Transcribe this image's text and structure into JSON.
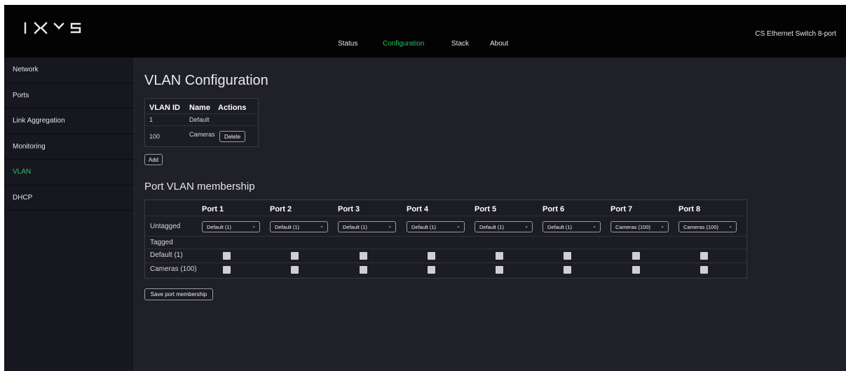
{
  "header": {
    "logo_text": "IXXS",
    "nav": [
      {
        "label": "Status",
        "active": false
      },
      {
        "label": "Configuration",
        "active": true
      },
      {
        "label": "Stack",
        "active": false
      },
      {
        "label": "About",
        "active": false
      }
    ],
    "device_name": "CS Ethernet Switch 8-port"
  },
  "sidebar": {
    "items": [
      {
        "label": "Network",
        "active": false
      },
      {
        "label": "Ports",
        "active": false
      },
      {
        "label": "Link Aggregation",
        "active": false
      },
      {
        "label": "Monitoring",
        "active": false
      },
      {
        "label": "VLAN",
        "active": true
      },
      {
        "label": "DHCP",
        "active": false
      }
    ]
  },
  "main": {
    "title": "VLAN Configuration",
    "vlan_table": {
      "headers": [
        "VLAN ID",
        "Name",
        "Actions"
      ],
      "rows": [
        {
          "id": "1",
          "name": "Default",
          "action": ""
        },
        {
          "id": "100",
          "name": "Cameras",
          "action": "Delete"
        }
      ]
    },
    "add_label": "Add",
    "membership_title": "Port VLAN membership",
    "port_table": {
      "ports": [
        "Port 1",
        "Port 2",
        "Port 3",
        "Port 4",
        "Port 5",
        "Port 6",
        "Port 7",
        "Port 8"
      ],
      "untagged_label": "Untagged",
      "untagged_values": [
        "Default (1)",
        "Default (1)",
        "Default (1)",
        "Default (1)",
        "Default (1)",
        "Default (1)",
        "Cameras (100)",
        "Cameras (100)"
      ],
      "tagged_label": "Tagged",
      "tagged_rows": [
        {
          "label": "Default (1)",
          "checked": [
            false,
            false,
            false,
            false,
            false,
            false,
            false,
            false
          ]
        },
        {
          "label": "Cameras (100)",
          "checked": [
            false,
            false,
            false,
            false,
            false,
            false,
            false,
            false
          ]
        }
      ]
    },
    "save_label": "Save port membership"
  },
  "colors": {
    "accent": "#22c55e",
    "background": "#202029",
    "topbar": "#030304",
    "sidebar": "#171720"
  },
  "icons": {
    "select_chevron": "chevron-down-icon"
  }
}
